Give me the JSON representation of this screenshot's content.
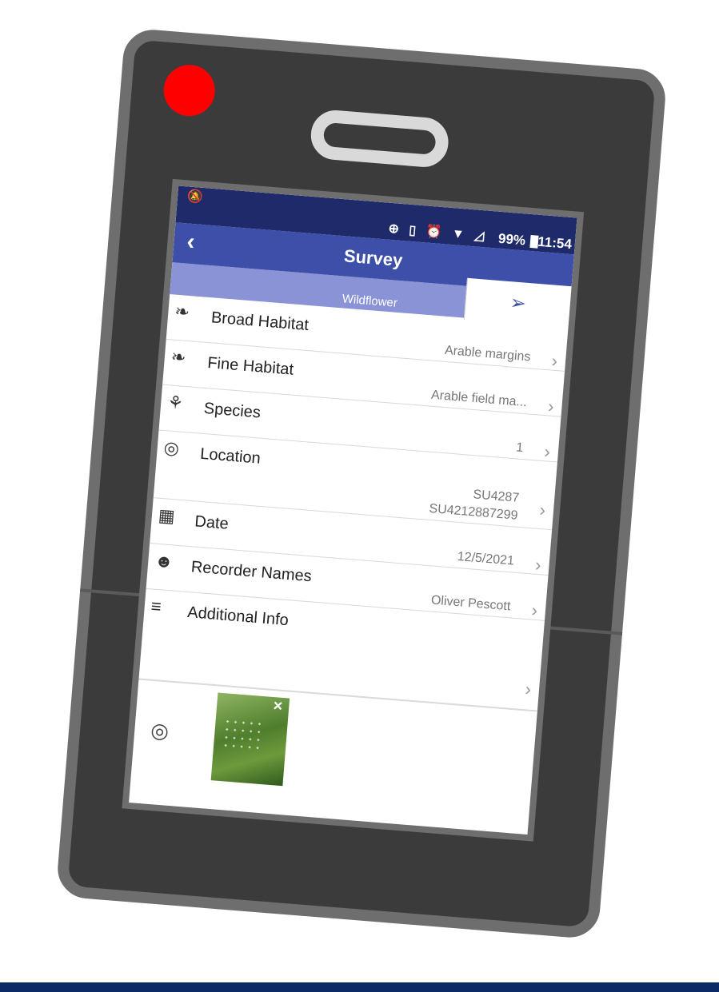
{
  "status": {
    "battery": "99%",
    "time": "11:54"
  },
  "header": {
    "back_icon": "chevron-left-icon",
    "title": "Survey",
    "send_icon": "paper-plane-icon"
  },
  "subheader": "Wildflower",
  "rows": [
    {
      "icon": "habitat-icon",
      "label": "Broad Habitat",
      "value": "Arable margins"
    },
    {
      "icon": "habitat-icon",
      "label": "Fine Habitat",
      "value": "Arable field ma..."
    },
    {
      "icon": "sprout-icon",
      "label": "Species",
      "value": "1"
    },
    {
      "icon": "location-pin-icon",
      "label": "Location",
      "value_line1": "SU4287",
      "value_line2": "SU4212887299"
    },
    {
      "icon": "calendar-icon",
      "label": "Date",
      "value": "12/5/2021"
    },
    {
      "icon": "add-person-icon",
      "label": "Recorder Names",
      "value": "Oliver Pescott"
    },
    {
      "icon": "text-lines-icon",
      "label": "Additional Info",
      "value": ""
    }
  ],
  "photo": {
    "camera_icon": "camera-icon",
    "remove_icon": "close-icon",
    "remove_label": "×"
  },
  "colors": {
    "status_bar": "#1f2a6b",
    "header": "#3d4fa8",
    "subheader": "#8a93d6",
    "device_body": "#3b3b3b",
    "device_frame": "#6e6e6e",
    "record_dot": "#ff0000",
    "bottom_band": "#0b2a66"
  }
}
